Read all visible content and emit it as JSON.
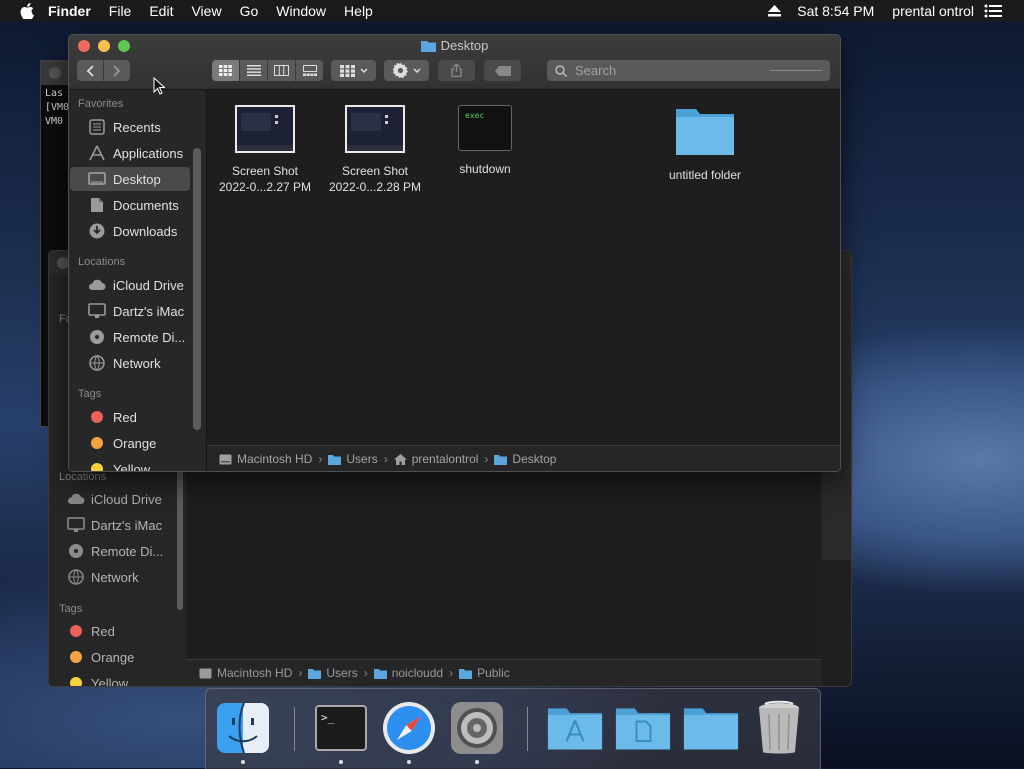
{
  "menubar": {
    "app": "Finder",
    "menus": [
      "File",
      "Edit",
      "View",
      "Go",
      "Window",
      "Help"
    ],
    "clock": "Sat 8:54 PM",
    "user": "prental ontrol",
    "icons": [
      "apple-icon",
      "eject-icon",
      "control-center-icon"
    ]
  },
  "background_terminal": {
    "lines": [
      "Las",
      "[VM0",
      "VM0"
    ]
  },
  "background_finder": {
    "sidebar": {
      "favorites_header_partial": "Fa",
      "locations_header": "Locations",
      "locations": [
        "iCloud Drive",
        "Dartz's iMac",
        "Remote Di...",
        "Network"
      ],
      "tags_header": "Tags",
      "tags": [
        {
          "label": "Red",
          "color": "#ec5f5b"
        },
        {
          "label": "Orange",
          "color": "#f6a443"
        },
        {
          "label": "Yellow",
          "color": "#f7d03c"
        }
      ]
    },
    "pathbar": [
      "Macintosh HD",
      "Users",
      "noicloudd",
      "Public"
    ]
  },
  "finder": {
    "title": "Desktop",
    "search_placeholder": "Search",
    "sidebar": {
      "favorites_header": "Favorites",
      "favorites": [
        {
          "label": "Recents",
          "icon": "recents-icon"
        },
        {
          "label": "Applications",
          "icon": "applications-icon"
        },
        {
          "label": "Desktop",
          "icon": "desktop-icon",
          "selected": true
        },
        {
          "label": "Documents",
          "icon": "documents-icon"
        },
        {
          "label": "Downloads",
          "icon": "downloads-icon"
        }
      ],
      "locations_header": "Locations",
      "locations": [
        {
          "label": "iCloud Drive",
          "icon": "icloud-icon"
        },
        {
          "label": "Dartz's iMac",
          "icon": "imac-icon"
        },
        {
          "label": "Remote Di...",
          "icon": "disc-icon"
        },
        {
          "label": "Network",
          "icon": "network-icon"
        }
      ],
      "tags_header": "Tags",
      "tags": [
        {
          "label": "Red",
          "color": "#ec5f5b"
        },
        {
          "label": "Orange",
          "color": "#f6a443"
        },
        {
          "label": "Yellow",
          "color": "#f7d03c"
        }
      ]
    },
    "files": [
      {
        "line1": "Screen Shot",
        "line2": "2022-0...2.27 PM",
        "kind": "screenshot"
      },
      {
        "line1": "Screen Shot",
        "line2": "2022-0...2.28 PM",
        "kind": "screenshot"
      },
      {
        "line1": "shutdown",
        "line2": "",
        "kind": "exec",
        "thumb_text": "exec"
      },
      {
        "line1": "untitled folder",
        "line2": "",
        "kind": "folder"
      }
    ],
    "pathbar": [
      "Macintosh HD",
      "Users",
      "prentalontrol",
      "Desktop"
    ]
  },
  "dock": {
    "items": [
      "finder-icon",
      "terminal-icon",
      "safari-icon",
      "system-preferences-icon",
      "applications-folder-icon",
      "documents-folder-icon",
      "downloads-folder-icon",
      "trash-icon"
    ],
    "terminal_prompt": ">_"
  }
}
